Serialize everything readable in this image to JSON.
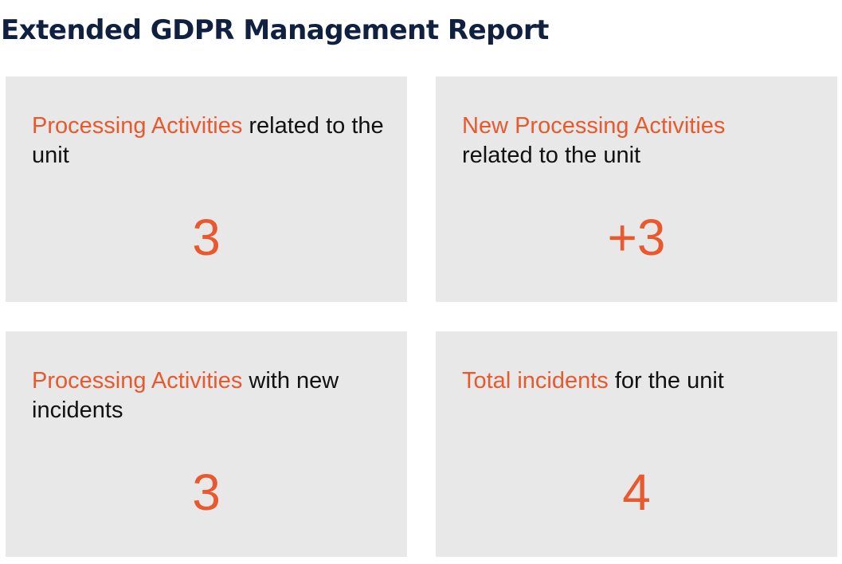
{
  "title": "Extended GDPR Management Report",
  "colors": {
    "accent": "#e8592d",
    "title": "#0f2040",
    "card_background": "#e9e8e8",
    "text": "#111111"
  },
  "cards": [
    {
      "label_highlight": "Processing Activities",
      "label_rest": " related to the unit",
      "value": "3"
    },
    {
      "label_highlight": "New Processing Activities",
      "label_rest": " related to the unit",
      "value": "+3"
    },
    {
      "label_highlight": "Processing Activities",
      "label_rest": " with new incidents",
      "value": "3"
    },
    {
      "label_highlight": "Total incidents",
      "label_rest": " for the unit",
      "value": "4"
    }
  ]
}
